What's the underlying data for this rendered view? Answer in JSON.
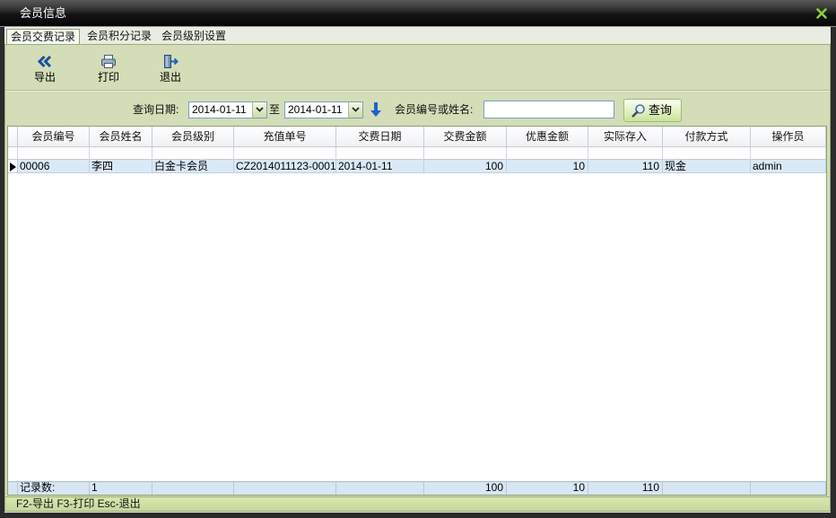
{
  "window": {
    "title": "会员信息"
  },
  "tabs": [
    {
      "label": "会员交费记录",
      "selected": true
    },
    {
      "label": "会员积分记录",
      "selected": false
    },
    {
      "label": "会员级别设置",
      "selected": false
    }
  ],
  "toolbar": {
    "export": {
      "label": "导出",
      "icon": "double-chevron-left-icon"
    },
    "print": {
      "label": "打印",
      "icon": "printer-icon"
    },
    "exit": {
      "label": "退出",
      "icon": "exit-door-icon"
    }
  },
  "search": {
    "date_label": "查询日期:",
    "date_from": "2014-01-11",
    "to_label": "至",
    "date_to": "2014-01-11",
    "keyword_label": "会员编号或姓名:",
    "keyword_value": "",
    "query_label": "查询",
    "query_icon": "magnifier-icon",
    "arrow_icon": "arrow-down-icon"
  },
  "grid": {
    "columns": [
      "会员编号",
      "会员姓名",
      "会员级别",
      "充值单号",
      "交费日期",
      "交费金额",
      "优惠金额",
      "实际存入",
      "付款方式",
      "操作员"
    ],
    "rows": [
      [
        "00006",
        "李四",
        "白金卡会员",
        "CZ2014011123-0001",
        "2014-01-11",
        "100",
        "10",
        "110",
        "现金",
        "admin"
      ]
    ],
    "footer": [
      "记录数:",
      "1",
      "",
      "",
      "",
      "100",
      "10",
      "110",
      "",
      ""
    ]
  },
  "status_bar": {
    "text": "F2-导出 F3-打印 Esc-退出"
  },
  "colors": {
    "toolbar_bg": "#d3ddb8",
    "tab_strip_bg": "#e9ede1",
    "selected_row_bg": "#dbe9f6",
    "footer_row_bg": "#d7e6f3",
    "status_bar_bg": "#c6d899",
    "close_icon": "#86d13b",
    "arrow_icon": "#1f62c9"
  }
}
